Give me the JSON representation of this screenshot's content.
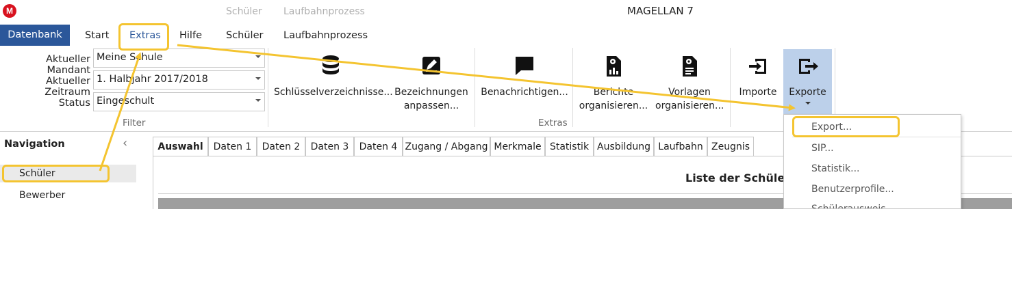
{
  "titlebar": {
    "logo_letter": "M",
    "ghost_tabs": [
      "Schüler",
      "Laufbahnprozess"
    ],
    "title": "MAGELLAN 7"
  },
  "menu": {
    "datenbank": "Datenbank",
    "start": "Start",
    "extras": "Extras",
    "hilfe": "Hilfe",
    "schueler": "Schüler",
    "laufbahnprozess": "Laufbahnprozess"
  },
  "filter": {
    "mandant_label": "Aktueller Mandant",
    "mandant_value": "Meine Schule",
    "zeitraum_label": "Aktueller Zeitraum",
    "zeitraum_value": "1. Halbjahr 2017/2018",
    "status_label": "Status",
    "status_value": "Eingeschult",
    "group_label": "Filter"
  },
  "extras": {
    "group_label": "Extras",
    "schluessel": "Schlüsselverzeichnisse...",
    "bezeichnungen_1": "Bezeichnungen",
    "bezeichnungen_2": "anpassen...",
    "benachrichtigen": "Benachrichtigen...",
    "berichte_1": "Berichte",
    "berichte_2": "organisieren...",
    "vorlagen_1": "Vorlagen",
    "vorlagen_2": "organisieren...",
    "importe": "Importe",
    "exporte": "Exporte"
  },
  "navigation": {
    "title": "Navigation",
    "collapse_glyph": "‹",
    "items": [
      "Schüler",
      "Bewerber"
    ]
  },
  "tabs": [
    "Auswahl",
    "Daten 1",
    "Daten 2",
    "Daten 3",
    "Daten 4",
    "Zugang / Abgang",
    "Merkmale",
    "Statistik",
    "Ausbildung",
    "Laufbahn",
    "Zeugnis"
  ],
  "content": {
    "list_title": "Liste der Schüler"
  },
  "export_menu": {
    "items": [
      "Export...",
      "SIP...",
      "Statistik...",
      "Benutzerprofile...",
      "Schülerausweis..."
    ]
  },
  "colors": {
    "accent_blue": "#2b579a",
    "ribbon_active": "#bcd0ea",
    "highlight": "#f4c430",
    "logo_red": "#d8121f"
  }
}
